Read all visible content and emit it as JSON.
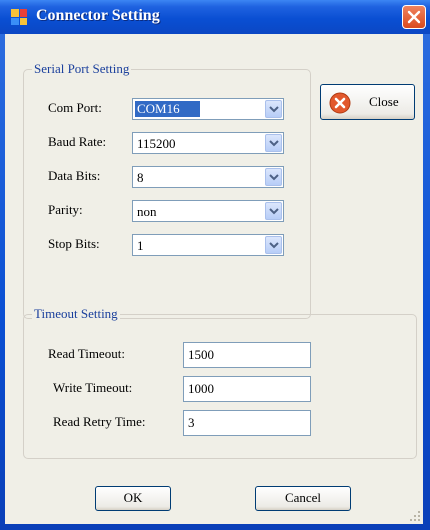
{
  "window": {
    "title": "Connector Setting"
  },
  "serial_group": {
    "title": "Serial Port Setting",
    "fields": [
      {
        "label": "Com Port:",
        "value": "COM16",
        "selected": true
      },
      {
        "label": "Baud Rate:",
        "value": "115200"
      },
      {
        "label": "Data Bits:",
        "value": "8"
      },
      {
        "label": "Parity:",
        "value": "non"
      },
      {
        "label": "Stop Bits:",
        "value": "1"
      }
    ]
  },
  "close_button": {
    "label": "Close",
    "icon": "close-circle-icon"
  },
  "timeout_group": {
    "title": "Timeout Setting",
    "fields": [
      {
        "label": "Read Timeout:",
        "value": "1500"
      },
      {
        "label": "Write Timeout:",
        "value": "1000"
      },
      {
        "label": "Read Retry Time:",
        "value": "3"
      }
    ]
  },
  "buttons": {
    "ok": "OK",
    "cancel": "Cancel"
  },
  "colors": {
    "titlebar": "#0a4fd3",
    "group_title": "#1a3f9c",
    "selection": "#316ac5"
  }
}
